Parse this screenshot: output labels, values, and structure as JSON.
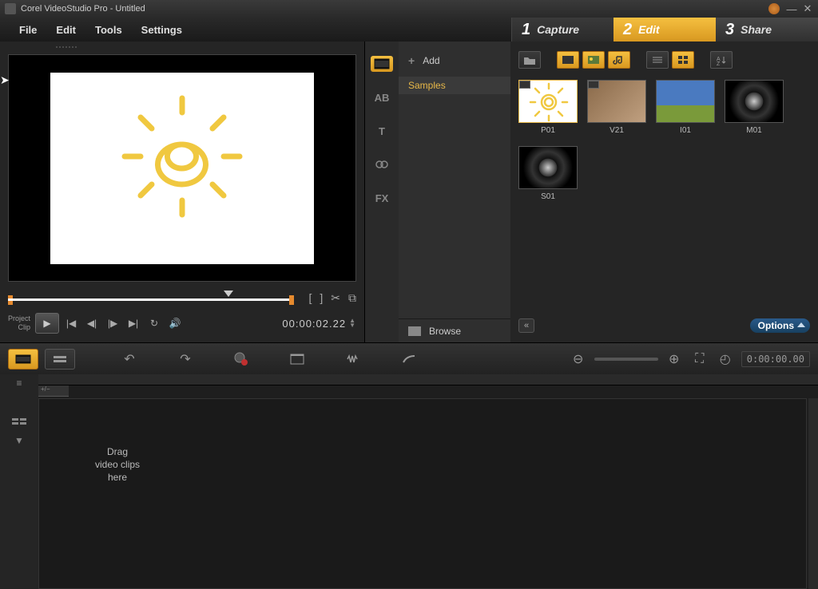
{
  "title": "Corel VideoStudio Pro - Untitled",
  "menu": {
    "file": "File",
    "edit": "Edit",
    "tools": "Tools",
    "settings": "Settings"
  },
  "steps": {
    "capture": {
      "num": "1",
      "label": "Capture"
    },
    "edit": {
      "num": "2",
      "label": "Edit"
    },
    "share": {
      "num": "3",
      "label": "Share"
    }
  },
  "preview": {
    "project_label": "Project",
    "clip_label": "Clip",
    "timecode": "00:00:02.22"
  },
  "library": {
    "add_label": "Add",
    "folder_selected": "Samples",
    "browse_label": "Browse",
    "options_label": "Options",
    "sidetabs": {
      "ab": "AB",
      "t": "T",
      "fx": "FX"
    },
    "thumbs": {
      "p01": "P01",
      "v21": "V21",
      "i01": "I01",
      "m01": "M01",
      "s01": "S01"
    }
  },
  "timeline": {
    "timecode": "0:00:00.00",
    "drop_hint": "Drag\nvideo clips\nhere",
    "header_tab": "+/−"
  }
}
